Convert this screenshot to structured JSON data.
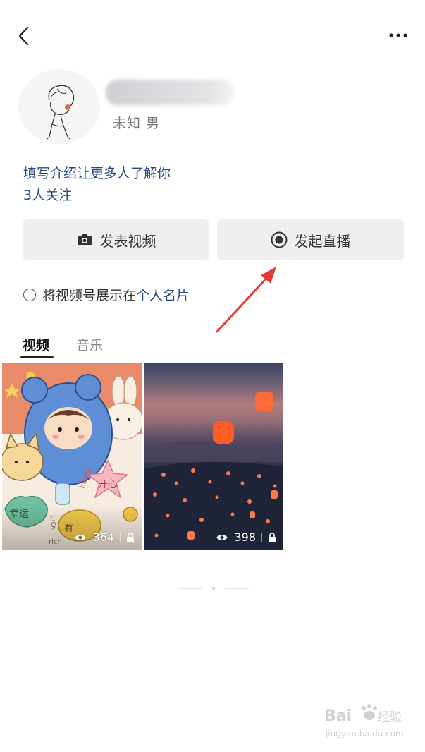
{
  "header": {
    "back_icon": "chevron-left-icon",
    "more_icon": "more-dots-icon"
  },
  "profile": {
    "meta": "未知 男",
    "bio_prompt": "填写介绍让更多人了解你",
    "followers": "3人关注"
  },
  "actions": {
    "post_video": {
      "label": "发表视频",
      "icon": "camera-icon"
    },
    "go_live": {
      "label": "发起直播",
      "icon": "record-icon"
    }
  },
  "card_option": {
    "prefix": "将视频号展示在",
    "link": "个人名片"
  },
  "tabs": [
    {
      "label": "视频",
      "active": true
    },
    {
      "label": "音乐",
      "active": false
    }
  ],
  "videos": [
    {
      "views": "364",
      "locked": true
    },
    {
      "views": "398",
      "locked": true
    }
  ],
  "thumbnail_text": [
    "幸运",
    "开心",
    "有",
    "happy",
    "luck",
    "rich"
  ],
  "watermark": {
    "main": "Bai",
    "sub": "经验",
    "url": "jingyan.baidu.com"
  },
  "colors": {
    "link": "#2b4a80",
    "arrow": "#e53935",
    "button_bg": "#efefef"
  }
}
